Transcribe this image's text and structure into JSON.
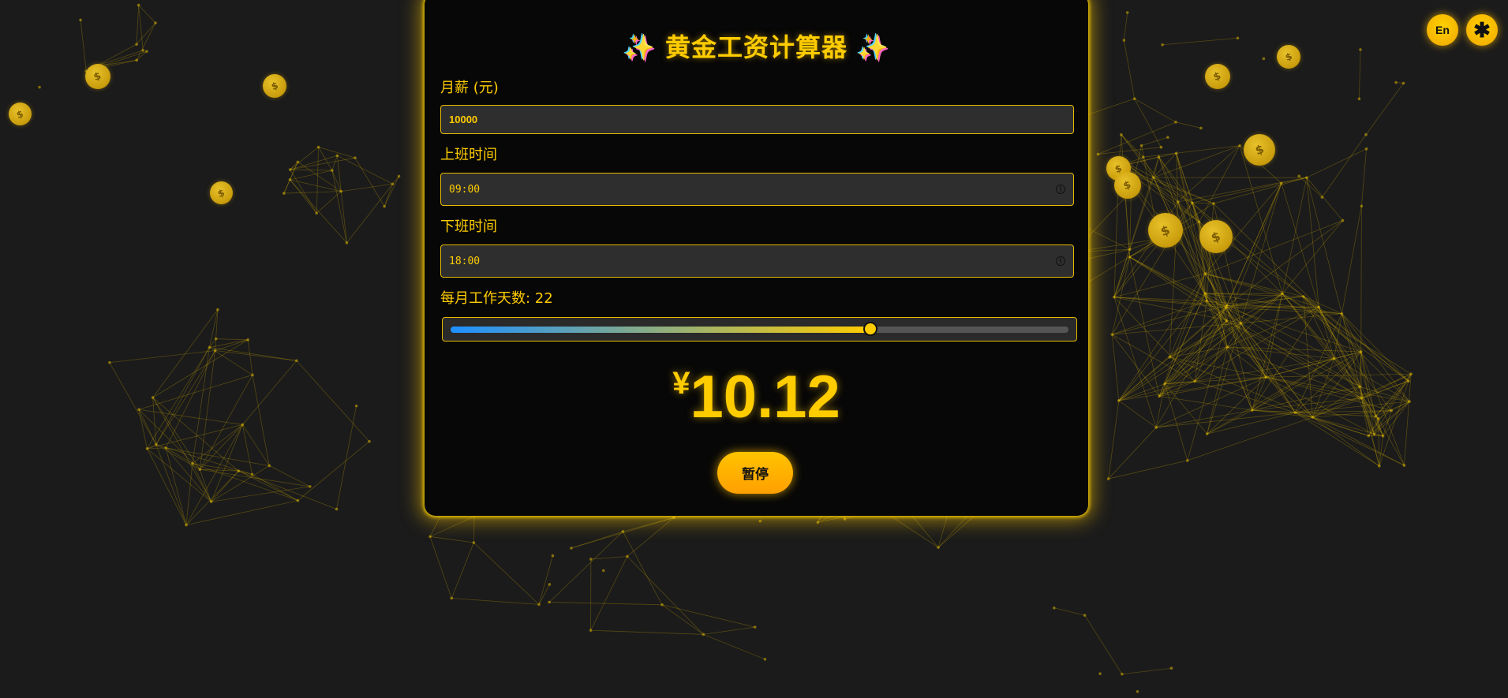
{
  "app": {
    "title": "黄金工资计算器",
    "sparkle_icon": "✨"
  },
  "form": {
    "salary_label": "月薪 (元)",
    "salary_value": "10000",
    "start_label": "上班时间",
    "start_value": "09:00",
    "end_label": "下班时间",
    "end_value": "18:00",
    "days_label": "每月工作天数: 22",
    "days_value": 22,
    "days_fraction": 0.68
  },
  "result": {
    "currency": "¥",
    "amount": "10.12"
  },
  "controls": {
    "pause_label": "暂停",
    "lang_label": "En",
    "theme_icon": "asterisk-icon"
  },
  "coin_icon_glyph": "$",
  "colors": {
    "accent": "#ffcc00",
    "background": "#1b1b1b",
    "card": "#070707",
    "slider_start": "#1e90ff"
  }
}
